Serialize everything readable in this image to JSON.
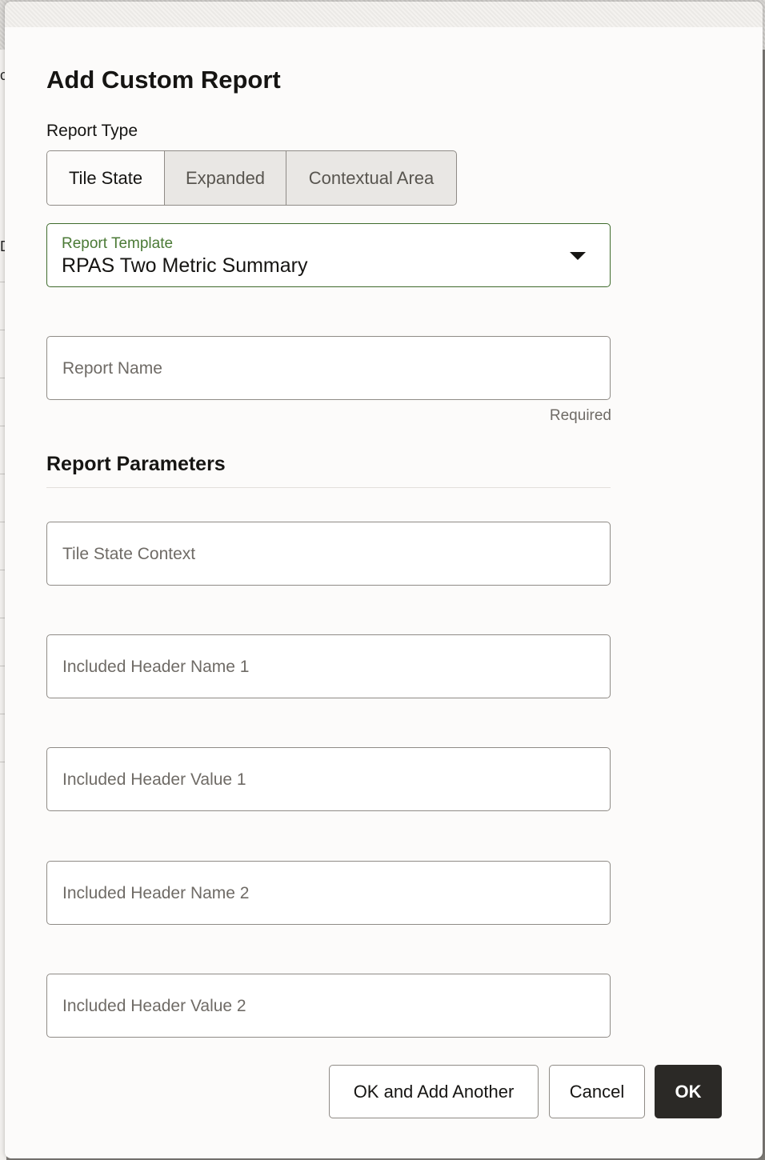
{
  "backdrop": {
    "glyphs": [
      "c",
      "D"
    ]
  },
  "dialog": {
    "title": "Add Custom Report",
    "report_type": {
      "label": "Report Type",
      "options": [
        "Tile State",
        "Expanded",
        "Contextual Area"
      ],
      "selected": "Tile State"
    },
    "report_template": {
      "label": "Report Template",
      "value": "RPAS Two Metric Summary"
    },
    "report_name": {
      "placeholder": "Report Name",
      "value": "",
      "helper": "Required"
    },
    "parameters": {
      "heading": "Report Parameters",
      "fields": [
        {
          "placeholder": "Tile State Context",
          "value": ""
        },
        {
          "placeholder": "Included Header Name 1",
          "value": ""
        },
        {
          "placeholder": "Included Header Value 1",
          "value": ""
        },
        {
          "placeholder": "Included Header Name 2",
          "value": ""
        },
        {
          "placeholder": "Included Header Value 2",
          "value": ""
        }
      ]
    },
    "buttons": {
      "ok_add_another": "OK and Add Another",
      "cancel": "Cancel",
      "ok": "OK"
    }
  },
  "colors": {
    "accent_green": "#4b7a36",
    "primary_button": "#2b2926",
    "dialog_background": "#fcfbfa"
  },
  "icons": {
    "dropdown": "chevron-down-icon"
  }
}
